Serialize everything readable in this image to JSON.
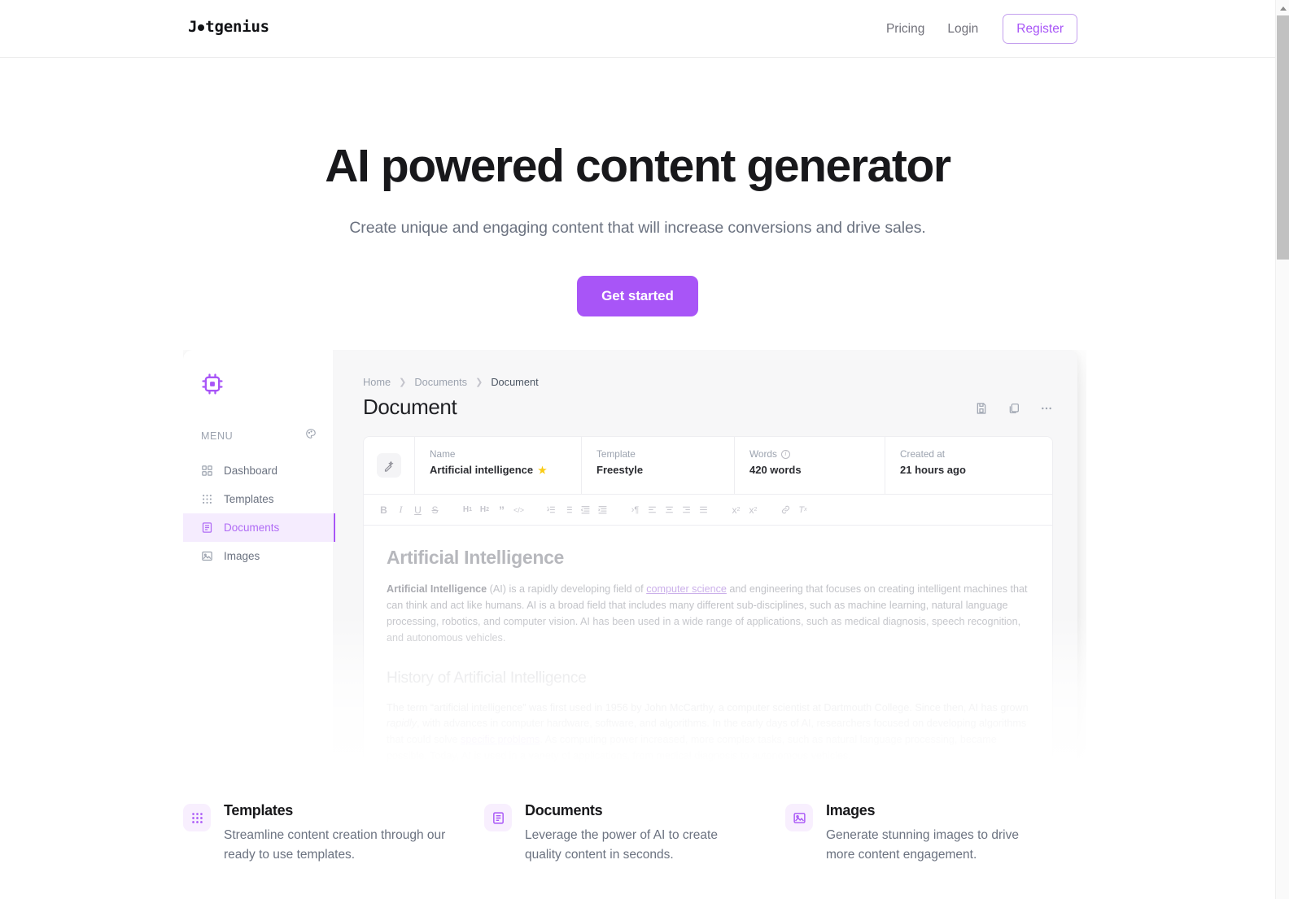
{
  "header": {
    "logo_text_before": "J",
    "logo_text_after": "tgenius",
    "nav": [
      {
        "label": "Pricing"
      },
      {
        "label": "Login"
      }
    ],
    "register_label": "Register"
  },
  "hero": {
    "title": "AI powered content generator",
    "subtitle": "Create unique and engaging content that will increase conversions and drive sales.",
    "cta_label": "Get started"
  },
  "app_screenshot": {
    "sidebar": {
      "logo_icon": "cpu-chip-icon",
      "menu_label": "MENU",
      "theme_icon": "palette-icon",
      "items": [
        {
          "label": "Dashboard",
          "icon": "grid-squares-icon",
          "active": false
        },
        {
          "label": "Templates",
          "icon": "dots-grid-icon",
          "active": false
        },
        {
          "label": "Documents",
          "icon": "document-lines-icon",
          "active": true
        },
        {
          "label": "Images",
          "icon": "image-icon",
          "active": false
        }
      ]
    },
    "breadcrumb": [
      {
        "label": "Home"
      },
      {
        "label": "Documents"
      },
      {
        "label": "Document"
      }
    ],
    "page_title": "Document",
    "actions": [
      {
        "icon": "save-disk-icon"
      },
      {
        "icon": "copy-icon"
      },
      {
        "icon": "more-horizontal-icon"
      }
    ],
    "meta": {
      "pen_icon": "magic-pen-icon",
      "name_label": "Name",
      "name_value": "Artificial intelligence",
      "favorite_icon": "star-icon",
      "template_label": "Template",
      "template_value": "Freestyle",
      "words_label": "Words",
      "words_info_icon": "info-icon",
      "words_value": "420 words",
      "created_label": "Created at",
      "created_value": "21 hours ago"
    },
    "toolbar": [
      {
        "label": "B",
        "name": "bold"
      },
      {
        "label": "I",
        "name": "italic"
      },
      {
        "label": "U",
        "name": "underline"
      },
      {
        "label": "S",
        "name": "strikethrough"
      },
      {
        "label": "H1",
        "name": "heading-1"
      },
      {
        "label": "H2",
        "name": "heading-2"
      },
      {
        "label": "”",
        "name": "blockquote"
      },
      {
        "label": "</>",
        "name": "code-block"
      },
      {
        "label": "1.",
        "name": "ordered-list"
      },
      {
        "label": "•",
        "name": "bullet-list"
      },
      {
        "label": "←",
        "name": "outdent"
      },
      {
        "label": "→",
        "name": "indent"
      },
      {
        "label": "¶",
        "name": "text-direction"
      },
      {
        "label": "≡",
        "name": "align-left"
      },
      {
        "label": "≡",
        "name": "align-center"
      },
      {
        "label": "≡",
        "name": "align-right"
      },
      {
        "label": "≡",
        "name": "align-justify"
      },
      {
        "label": "x",
        "name": "subscript",
        "script": "sub",
        "script_label": "2"
      },
      {
        "label": "x",
        "name": "superscript",
        "script": "sup",
        "script_label": "2"
      },
      {
        "label": "🔗",
        "name": "link"
      },
      {
        "label": "Tx",
        "name": "clear-formatting"
      }
    ],
    "document": {
      "h1": "Artificial Intelligence",
      "p1_bold": "Artificial Intelligence",
      "p1_part1": " (AI) is a rapidly developing field of ",
      "p1_link": "computer science",
      "p1_part2": " and engineering that focuses on creating intelligent machines that can think and act like humans. AI is a broad field that includes many different sub-disciplines, such as machine learning, natural language processing, robotics, and computer vision. AI has been used in a wide range of applications, such as medical diagnosis, speech recognition, and autonomous vehicles.",
      "h2": "History of Artificial Intelligence",
      "p2_part1": "The term “artificial intelligence” was first used in 1956 by John McCarthy, a computer scientist at Dartmouth College. Since then, AI has grown ",
      "p2_italic": "rapidly",
      "p2_part2": ", with advances in computer hardware, software, and algorithms. In the early days of AI, researchers focused on developing algorithms that could solve ",
      "p2_link": "specific problems",
      "p2_part3": ". As computing power increased, more complex tasks, such as natural language processing, became possible. Today, AI is used in a variety of applications, from medical diagnosis to autonomous vehicles."
    }
  },
  "features": [
    {
      "icon": "dots-grid-icon",
      "title": "Templates",
      "desc": "Streamline content creation through our ready to use templates."
    },
    {
      "icon": "document-lines-icon",
      "title": "Documents",
      "desc": "Leverage the power of AI to create quality content in seconds."
    },
    {
      "icon": "image-icon",
      "title": "Images",
      "desc": "Generate stunning images to drive more content engagement."
    }
  ],
  "colors": {
    "accent": "#a855f7",
    "accent_soft": "#f5ecfe",
    "text_dark": "#18181b",
    "text_muted": "#6b7280",
    "star": "#facc15"
  }
}
